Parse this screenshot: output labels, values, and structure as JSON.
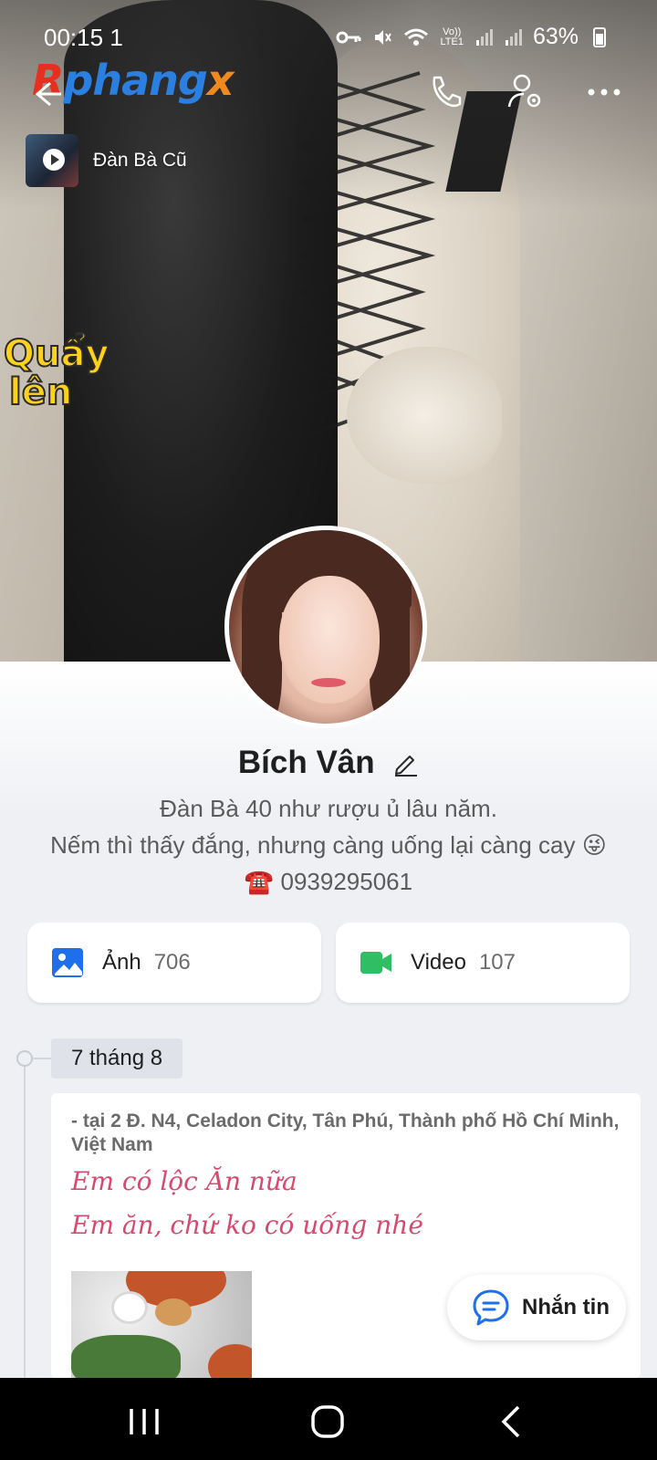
{
  "status_bar": {
    "time": "00:15",
    "notif": "1",
    "battery": "63%",
    "network": "LTE1"
  },
  "header": {
    "logo": [
      "R",
      "phang",
      "x"
    ],
    "music_title": "Đàn Bà Cũ"
  },
  "cover": {
    "sticker_line1": "Quẩy",
    "sticker_line2": "lên"
  },
  "profile": {
    "name": "Bích Vân",
    "bio_line1": "Đàn Bà 40 như rượu ủ lâu năm.",
    "bio_line2": "Nếm thì thấy đắng, nhưng càng uống lại càng cay 😜",
    "bio_line3": "☎️ 0939295061"
  },
  "media": {
    "photos_label": "Ảnh",
    "photos_count": "706",
    "videos_label": "Video",
    "videos_count": "107"
  },
  "timeline": {
    "date": "7 tháng 8",
    "post": {
      "location": " - tại 2 Đ. N4, Celadon City, Tân Phú, Thành phố Hồ Chí Minh, Việt Nam",
      "line1": "Em có lộc Ăn nữa",
      "line2": "Em ăn, chứ ko có uống nhé"
    }
  },
  "message_button": {
    "label": "Nhắn tin"
  },
  "colors": {
    "accent_blue": "#1f6feb",
    "video_green": "#2fbe64",
    "post_pink": "#d8496e"
  }
}
